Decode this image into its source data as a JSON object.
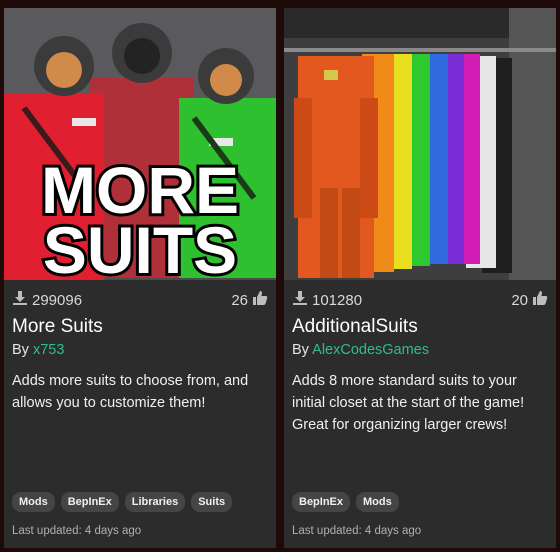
{
  "mods": [
    {
      "image_alt": "MORE SUITS",
      "image_text_line1": "MORE",
      "image_text_line2": "SUITS",
      "downloads": "299096",
      "likes": "26",
      "title": "More Suits",
      "by_prefix": "By",
      "author": "x753",
      "description": "Adds more suits to choose from, and allows you to customize them!",
      "tags": [
        "Mods",
        "BepInEx",
        "Libraries",
        "Suits"
      ],
      "last_updated": "Last updated: 4 days ago"
    },
    {
      "downloads": "101280",
      "likes": "20",
      "title": "AdditionalSuits",
      "by_prefix": "By",
      "author": "AlexCodesGames",
      "description": "Adds 8 more standard suits to your initial closet at the start of the game! Great for organizing larger crews!",
      "tags": [
        "BepInEx",
        "Mods"
      ],
      "last_updated": "Last updated: 4 days ago"
    }
  ],
  "icons": {
    "downloads": "download-icon",
    "likes": "thumbs-up-icon"
  },
  "colors": {
    "author_link": "#2dbf8a",
    "card_bg": "#2c2c2c",
    "page_bg": "#1f0a0a",
    "tag_bg": "#454545"
  }
}
